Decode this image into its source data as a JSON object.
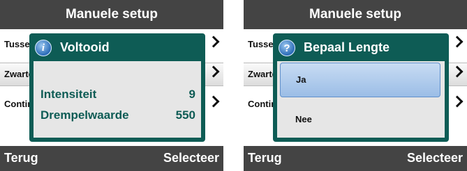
{
  "screens": [
    {
      "title": "Manuele setup",
      "menu": [
        {
          "label": "Tussenruimte"
        },
        {
          "label": "Zwarte markering"
        },
        {
          "label": "Continu"
        }
      ],
      "bottom": {
        "back": "Terug",
        "select": "Selecteer"
      },
      "dialog": {
        "icon": "info-icon",
        "icon_glyph": "i",
        "title": "Voltooid",
        "rows": [
          {
            "label": "Intensiteit",
            "value": "9"
          },
          {
            "label": "Drempelwaarde",
            "value": "550"
          }
        ]
      }
    },
    {
      "title": "Manuele setup",
      "menu": [
        {
          "label": "Tussenruimte"
        },
        {
          "label": "Zwarte markering"
        },
        {
          "label": "Continu"
        }
      ],
      "bottom": {
        "back": "Terug",
        "select": "Selecteer"
      },
      "dialog": {
        "icon": "question-icon",
        "icon_glyph": "?",
        "title": "Bepaal Lengte",
        "options": [
          {
            "label": "Ja",
            "highlighted": true
          },
          {
            "label": "Nee",
            "highlighted": false
          }
        ]
      }
    }
  ],
  "colors": {
    "bar_background": "#444444",
    "dialog_teal": "#0e5c55",
    "dialog_body": "#e6e6e6",
    "highlight_blue": "#9bbde6"
  }
}
